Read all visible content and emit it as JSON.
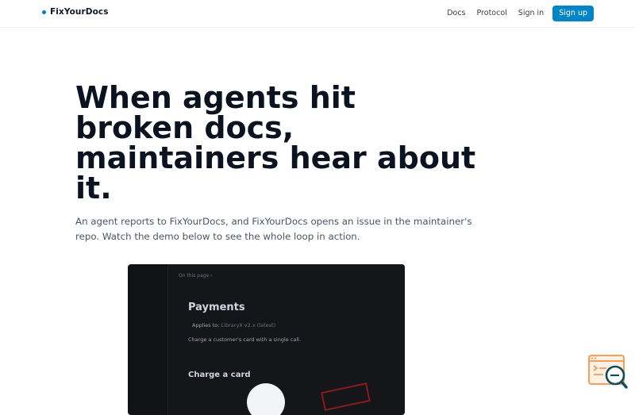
{
  "header": {
    "brand": "FixYourDocs",
    "nav": {
      "docs": "Docs",
      "protocol": "Protocol",
      "sign_in": "Sign in",
      "sign_up": "Sign up"
    }
  },
  "hero": {
    "title_lines": [
      "When agents hit",
      "broken docs,",
      "maintainers hear about",
      "it."
    ],
    "subtitle_lines": [
      "An agent reports to FixYourDocs, and FixYourDocs opens an issue in the maintainer's",
      "repo. Watch the demo below to see the whole loop in action."
    ]
  },
  "video": {
    "on_this_page": "On this page ›",
    "doc_title": "Payments",
    "applies_label": "Applies to:",
    "applies_value": "LibraryX v2.x (latest)",
    "description": "Charge a customer's card with a single call.",
    "section_heading": "Charge a card"
  },
  "widget": {
    "icon": "chat-search-icon"
  },
  "colors": {
    "brand_dot": "#0a7cc4",
    "signup_bg": "#0284c7",
    "title": "#0b1220",
    "subtitle": "#4b5563",
    "video_bg": "#111215",
    "widget_orange": "#f59e57"
  }
}
